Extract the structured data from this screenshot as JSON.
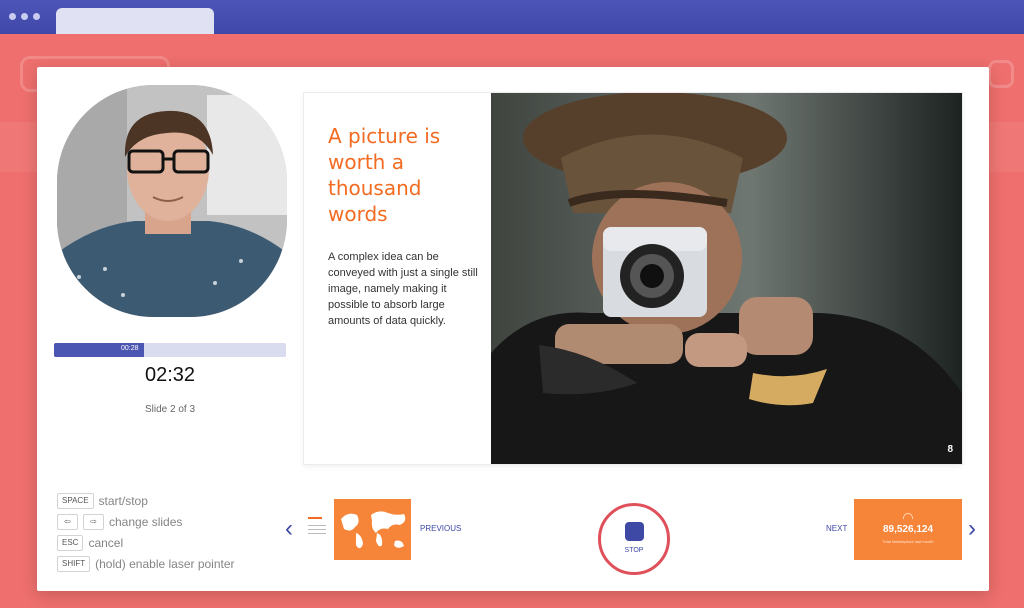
{
  "presenter": {
    "progress_label": "00:28",
    "progress_fraction": 0.39,
    "timer": "02:32",
    "slide_status": "Slide 2 of 3"
  },
  "slide": {
    "title": "A picture is worth a thousand words",
    "body": "A complex idea can be conveyed with just a single still image, namely making it possible to absorb large amounts of data quickly.",
    "number": "8"
  },
  "shortcuts": [
    {
      "keys": [
        "SPACE"
      ],
      "label": "start/stop"
    },
    {
      "keys": [
        "⇦",
        "⇨"
      ],
      "label": "change slides"
    },
    {
      "keys": [
        "ESC"
      ],
      "label": "cancel"
    },
    {
      "keys": [
        "SHIFT"
      ],
      "label": "(hold) enable laser pointer"
    }
  ],
  "navigation": {
    "previous_label": "PREVIOUS",
    "next_label": "NEXT",
    "stop_label": "STOP",
    "previous_arrow": "‹",
    "next_arrow": "›",
    "next_thumbnail_value": "89,526,124",
    "next_thumbnail_caption": "Total Marketplace last month"
  },
  "colors": {
    "background": "#ee6f6d",
    "browser_bar": "#4d56b8",
    "accent": "#3e49a6",
    "slide_title": "#f26b21",
    "thumbnail": "#f6853a"
  }
}
